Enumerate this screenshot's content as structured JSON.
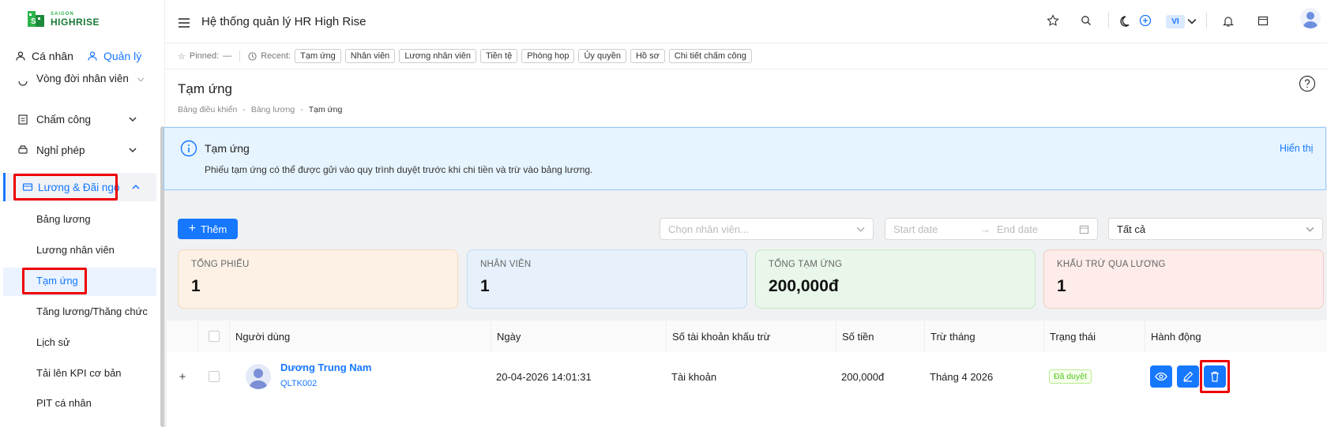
{
  "brand": {
    "line1": "SAIGON",
    "line2": "HIGHRISE"
  },
  "sidebar": {
    "mode_tabs": [
      {
        "label": "Cá nhân"
      },
      {
        "label": "Quản lý"
      }
    ],
    "items": [
      {
        "label": "Vòng đời nhân viên",
        "icon": "lifecycle-icon"
      },
      {
        "label": "Chấm công",
        "icon": "calendar-check-icon"
      },
      {
        "label": "Nghỉ phép",
        "icon": "car-icon"
      },
      {
        "label": "Lương & Đãi ngộ",
        "icon": "wallet-icon"
      }
    ],
    "subitems": [
      {
        "label": "Bảng lương"
      },
      {
        "label": "Lương nhân viên"
      },
      {
        "label": "Tạm ứng"
      },
      {
        "label": "Tăng lương/Thăng chức"
      },
      {
        "label": "Lịch sử"
      },
      {
        "label": "Tải lên KPI cơ bản"
      },
      {
        "label": "PIT cá nhân"
      }
    ]
  },
  "header": {
    "title": "Hệ thống quản lý HR High Rise",
    "lang": "VI"
  },
  "recent": {
    "pinned_label": "Pinned:",
    "pinned_value": "—",
    "recent_label": "Recent:",
    "chips": [
      "Tạm ứng",
      "Nhân viên",
      "Lương nhân viên",
      "Tiền tệ",
      "Phòng họp",
      "Ủy quyền",
      "Hồ sơ",
      "Chi tiết chấm công"
    ]
  },
  "page": {
    "title": "Tạm ứng",
    "breadcrumb": [
      "Bảng điều khiển",
      "Bảng lương",
      "Tạm ứng"
    ],
    "breadcrumb_sep": "-"
  },
  "alert": {
    "title": "Tạm ứng",
    "text": "Phiếu tạm ứng có thể được gửi vào quy trình duyệt trước khi chi tiền và trừ vào bảng lương.",
    "action": "Hiển thị"
  },
  "toolbar": {
    "add_label": "Thêm",
    "employee_placeholder": "Chọn nhân viên...",
    "start_placeholder": "Start date",
    "end_placeholder": "End date",
    "status_value": "Tất cả"
  },
  "stats": [
    {
      "title": "TỔNG PHIẾU",
      "value": "1",
      "bg": "#fdf1e6"
    },
    {
      "title": "NHÂN VIÊN",
      "value": "1",
      "bg": "#e6f1fc"
    },
    {
      "title": "TỔNG TẠM ỨNG",
      "value": "200,000đ",
      "bg": "#e8f7ea"
    },
    {
      "title": "KHẤU TRỪ QUA LƯƠNG",
      "value": "1",
      "bg": "#fdecea"
    }
  ],
  "table": {
    "columns": [
      "Người dùng",
      "Ngày",
      "Số tài khoản khấu trừ",
      "Số tiền",
      "Trừ tháng",
      "Trạng thái",
      "Hành động"
    ],
    "rows": [
      {
        "name": "Dương Trung Nam",
        "code": "QLTK002",
        "date": "20-04-2026 14:01:31",
        "account": "Tài khoản",
        "amount": "200,000đ",
        "month": "Tháng 4 2026",
        "status": "Đã duyệt"
      }
    ]
  },
  "colors": {
    "primary": "#1677ff",
    "highlight": "#e00000",
    "status_green": "#52c41a"
  }
}
